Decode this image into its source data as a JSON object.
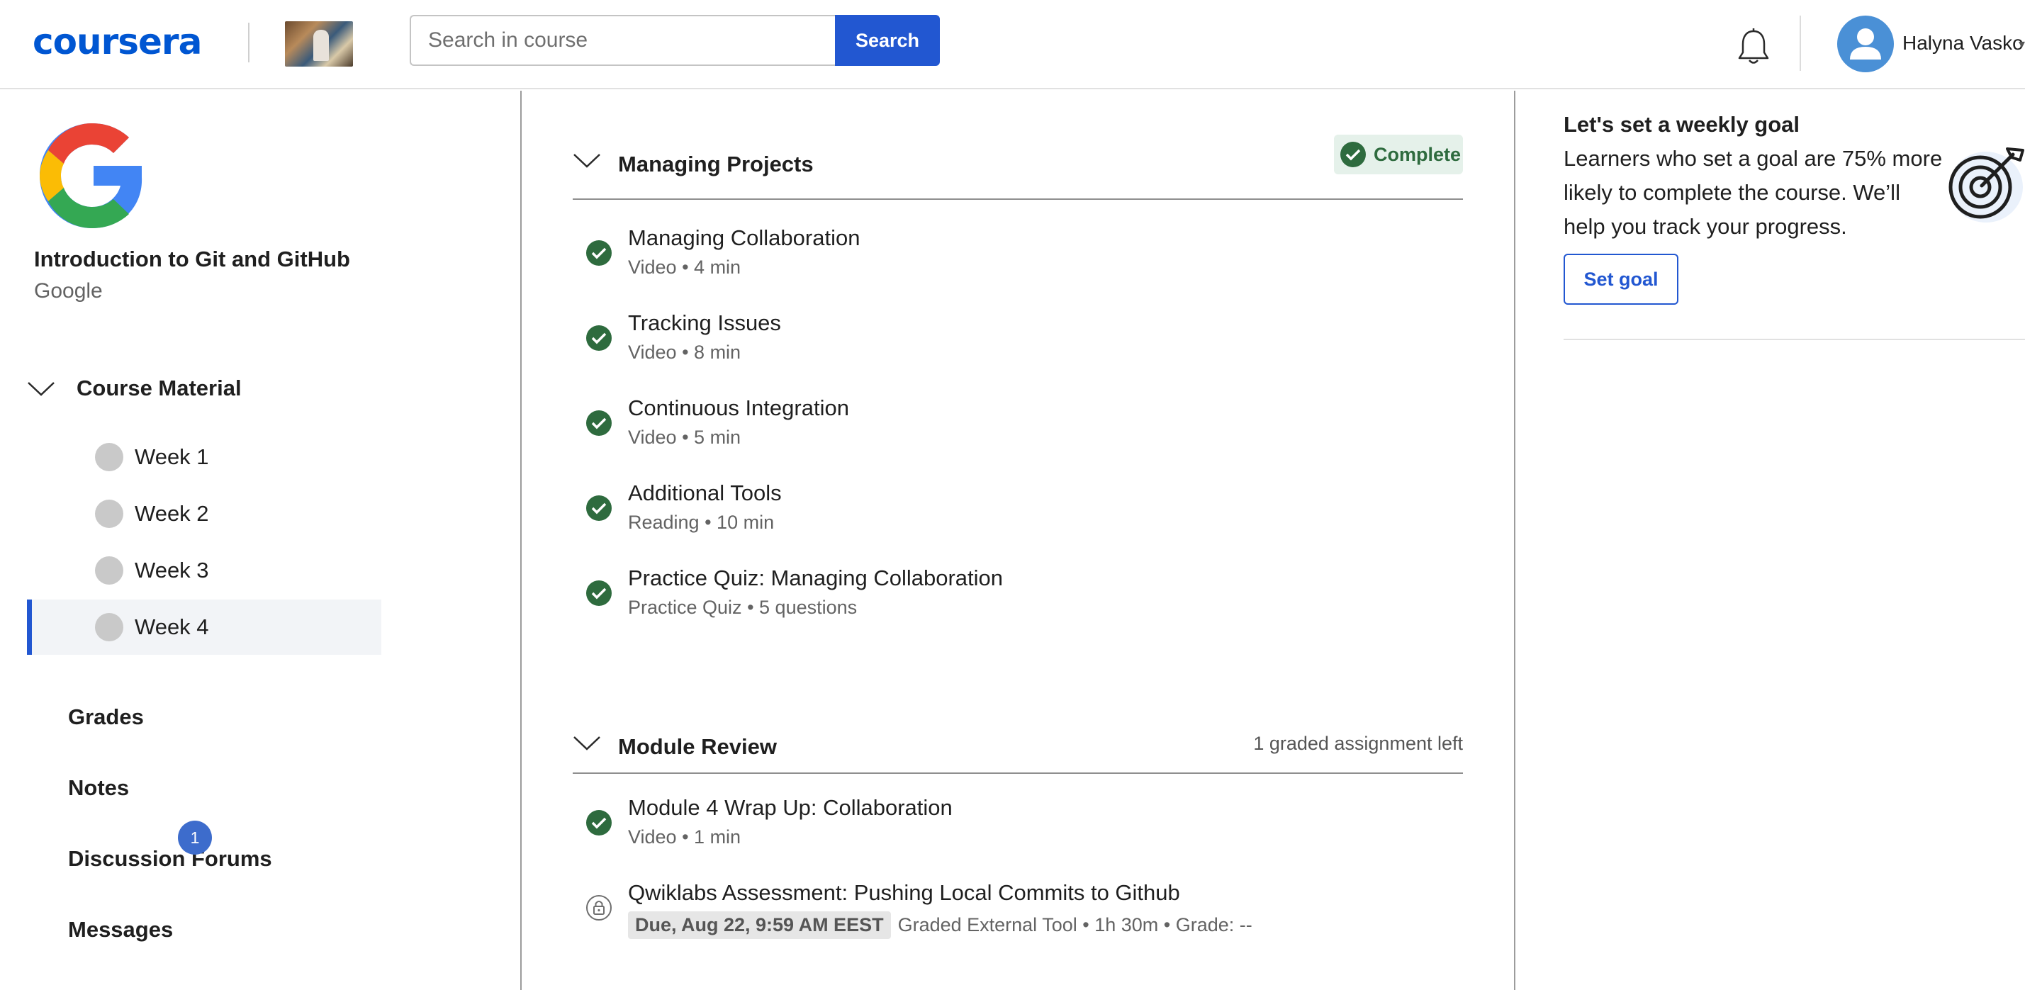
{
  "header": {
    "logo": "coursera",
    "search_placeholder": "Search in course",
    "search_button": "Search",
    "user_name": "Halyna Vasko"
  },
  "sidebar": {
    "course_title": "Introduction to Git and GitHub",
    "partner": "Google",
    "course_material_label": "Course Material",
    "weeks": [
      "Week 1",
      "Week 2",
      "Week 3",
      "Week 4"
    ],
    "active_week": "Week 4",
    "links": [
      "Grades",
      "Notes",
      "Discussion Forums",
      "Messages"
    ],
    "messages_badge": "1"
  },
  "main": {
    "sections": [
      {
        "title": "Managing Projects",
        "status": "Complete",
        "items": [
          {
            "name": "Managing Collaboration",
            "type": "Video",
            "detail": "4 min",
            "completed": true
          },
          {
            "name": "Tracking Issues",
            "type": "Video",
            "detail": "8 min",
            "completed": true
          },
          {
            "name": "Continuous Integration",
            "type": "Video",
            "detail": "5 min",
            "completed": true
          },
          {
            "name": "Additional Tools",
            "type": "Reading",
            "detail": "10 min",
            "completed": true
          },
          {
            "name": "Practice Quiz: Managing Collaboration",
            "type": "Practice Quiz",
            "detail": "5 questions",
            "completed": true
          }
        ]
      },
      {
        "title": "Module Review",
        "status": "1 graded assignment left",
        "items": [
          {
            "name": "Module 4 Wrap Up: Collaboration",
            "type": "Video",
            "detail": "1 min",
            "completed": true
          },
          {
            "name": "Qwiklabs Assessment: Pushing Local Commits to Github",
            "due": "Due, Aug 22, 9:59 AM EEST",
            "type": "Graded External Tool",
            "detail": "1h 30m",
            "grade": "Grade: --",
            "completed": false,
            "locked": true
          }
        ]
      }
    ]
  },
  "right_panel": {
    "goal_title": "Let's set a weekly goal",
    "goal_description": "Learners who set a goal are 75% more likely to complete the course. We’ll help you track your progress.",
    "set_goal_button": "Set goal"
  },
  "colors": {
    "brand": "#0056d2",
    "button_blue": "#2257d1",
    "complete_green": "#2e6b3e",
    "complete_bg": "#e5f1ea"
  },
  "icons": [
    "bell-icon",
    "avatar-icon",
    "chevron-down-icon",
    "check-circle-icon",
    "lock-icon",
    "target-icon",
    "google-g-logo"
  ]
}
